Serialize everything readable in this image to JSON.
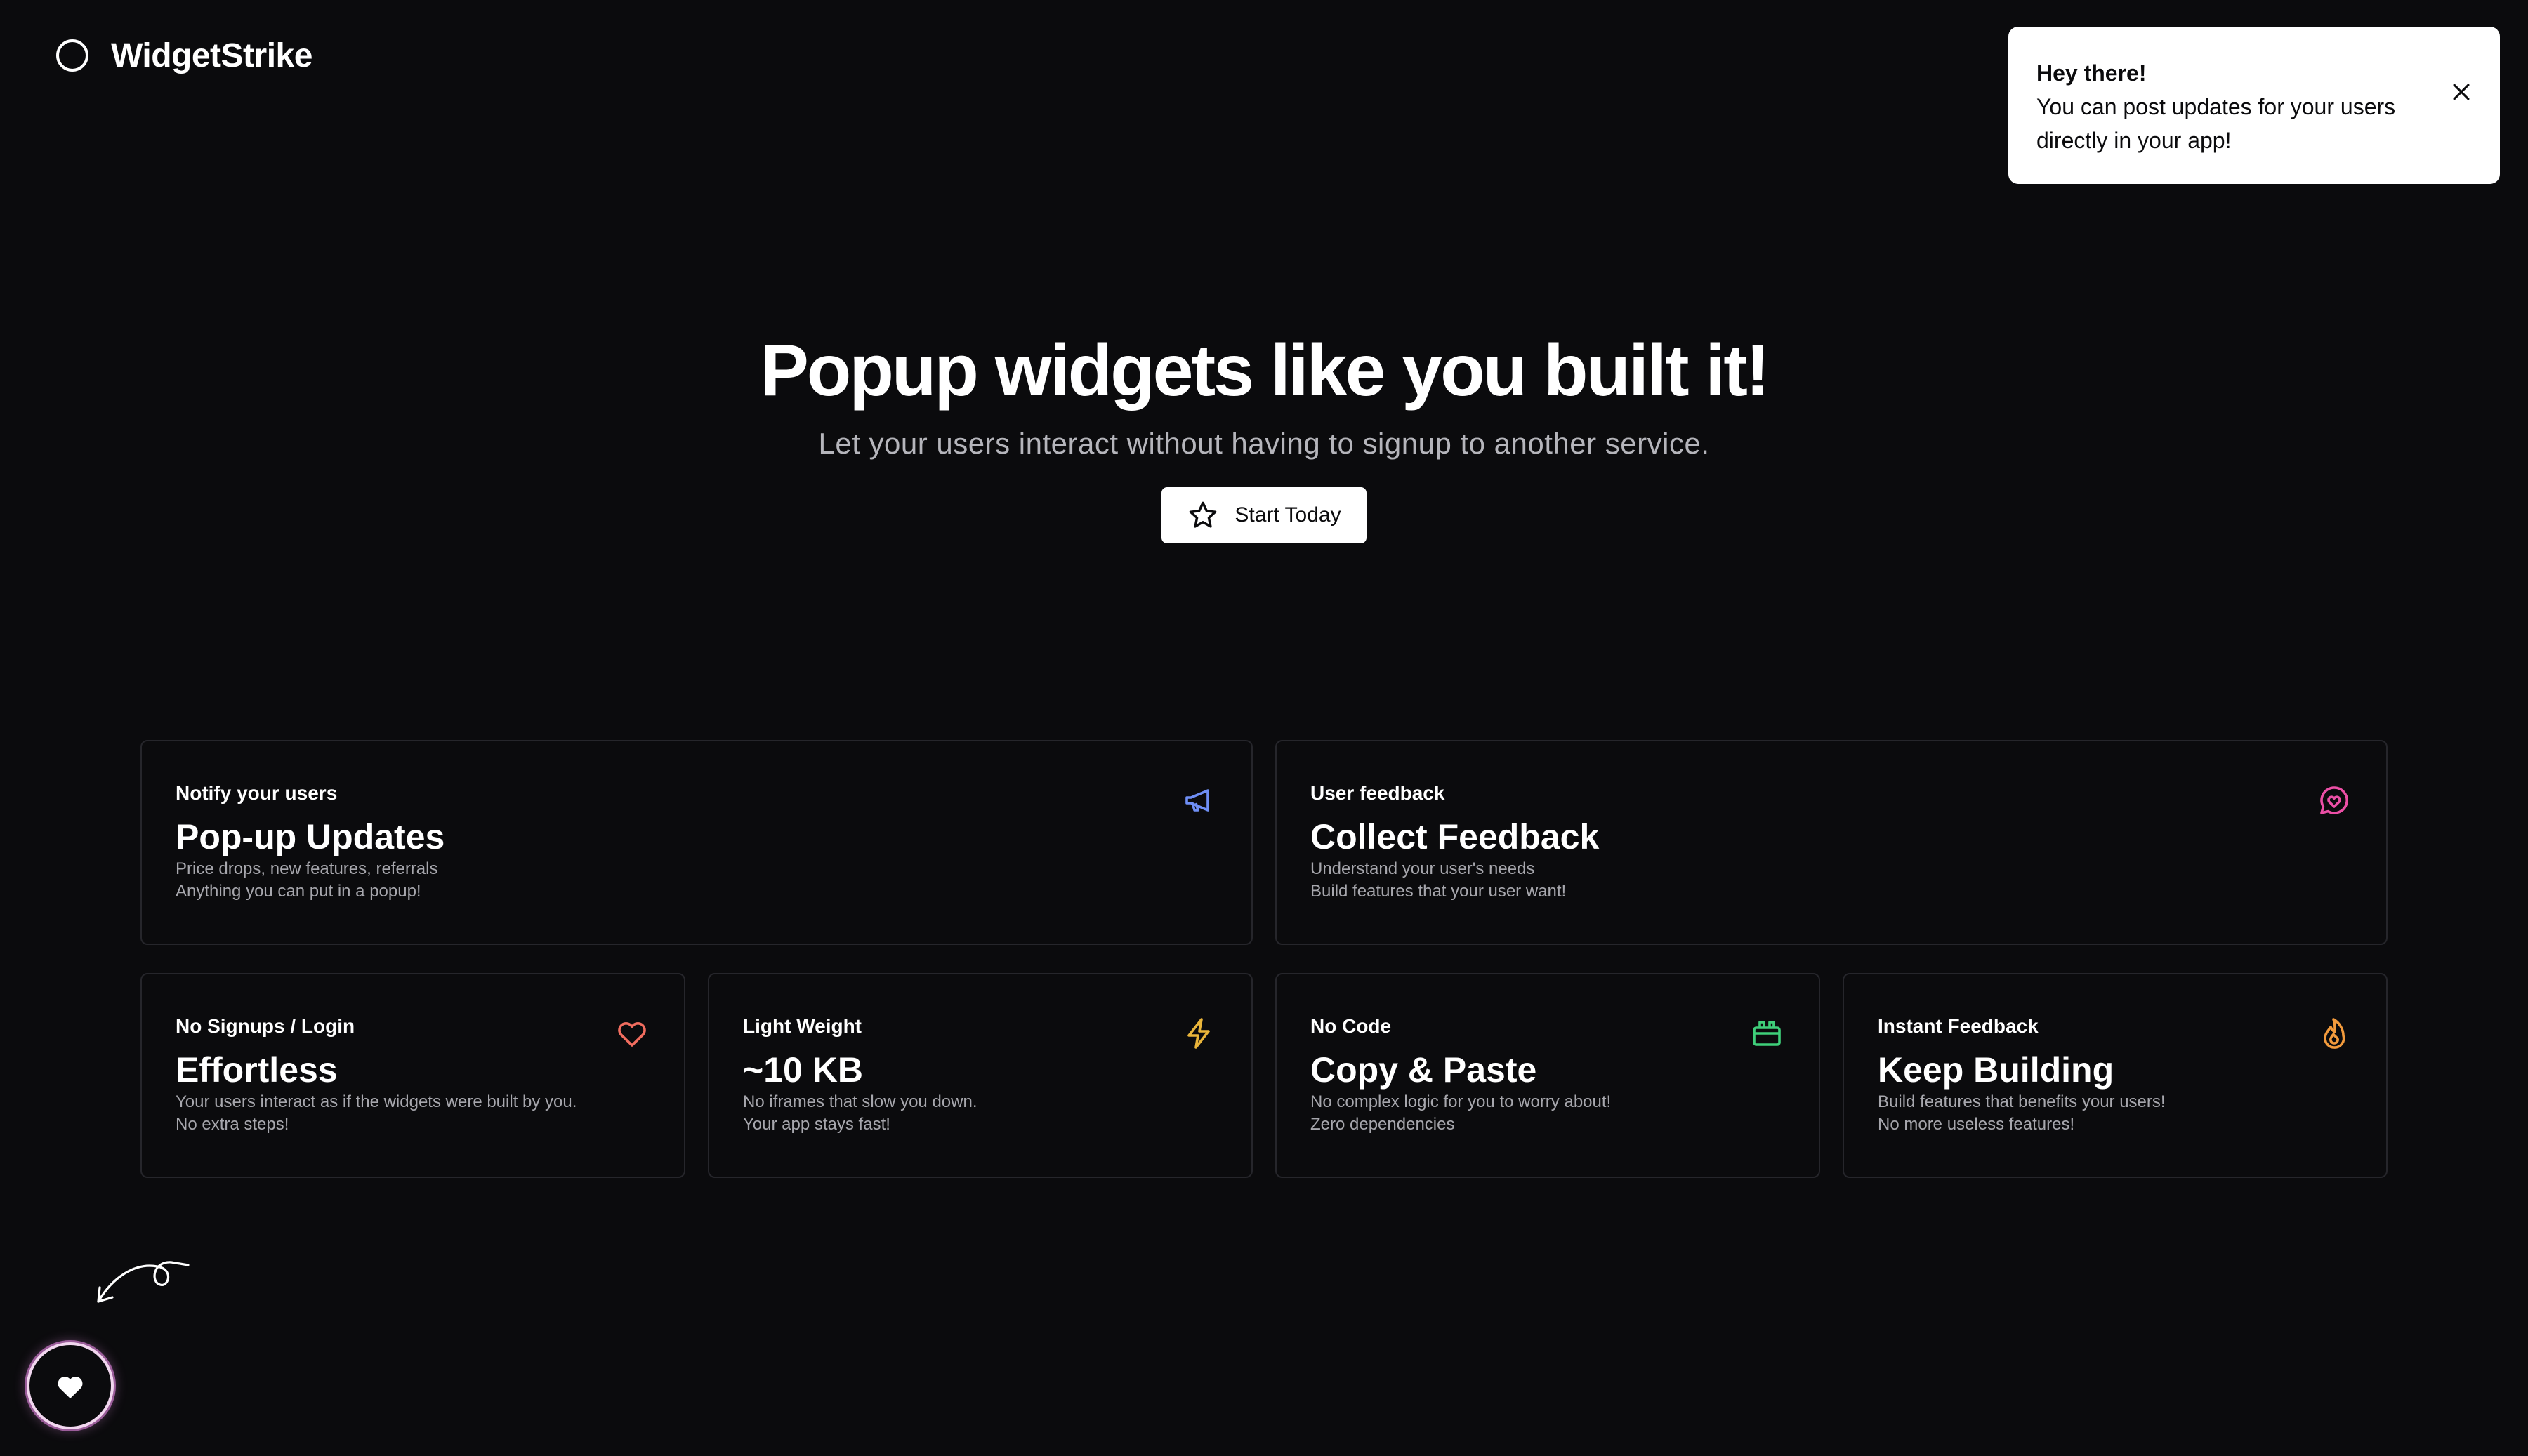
{
  "header": {
    "brand_name": "WidgetStrike",
    "logo_icon": "circle-logo-icon"
  },
  "toast": {
    "title": "Hey there!",
    "body": "You can post updates for your users directly in your app!",
    "close_icon": "close-icon"
  },
  "hero": {
    "title": "Popup widgets like you built it!",
    "subtitle": "Let your users interact without having to signup to another service.",
    "cta_label": "Start Today",
    "cta_icon": "star-icon"
  },
  "cards": [
    {
      "kicker": "Notify your users",
      "title": "Pop-up Updates",
      "lines": [
        "Price drops, new features, referrals",
        "Anything you can put in a popup!"
      ],
      "icon": "megaphone-icon",
      "icon_color": "#6f8ff5"
    },
    {
      "kicker": "User feedback",
      "title": "Collect Feedback",
      "lines": [
        "Understand your user's needs",
        "Build features that your user want!"
      ],
      "icon": "message-heart-icon",
      "icon_color": "#ec4fa6"
    },
    {
      "kicker": "No Signups / Login",
      "title": "Effortless",
      "lines": [
        "Your users interact as if the widgets were built by you.",
        "No extra steps!"
      ],
      "icon": "heart-icon",
      "icon_color": "#f26d5f"
    },
    {
      "kicker": "Light Weight",
      "title": "~10 KB",
      "lines": [
        "No iframes that slow you down.",
        "Your app stays fast!"
      ],
      "icon": "lightning-icon",
      "icon_color": "#eab53a"
    },
    {
      "kicker": "No Code",
      "title": "Copy & Paste",
      "lines": [
        "No complex logic for you to worry about!",
        "Zero dependencies"
      ],
      "icon": "box-icon",
      "icon_color": "#3fcf7a"
    },
    {
      "kicker": "Instant Feedback",
      "title": "Keep Building",
      "lines": [
        "Build features that benefits your users!",
        "No more useless features!"
      ],
      "icon": "flame-icon",
      "icon_color": "#f39b3c"
    }
  ],
  "floating": {
    "arrow_icon": "curly-arrow-icon",
    "fab_icon": "heart-filled-icon"
  }
}
